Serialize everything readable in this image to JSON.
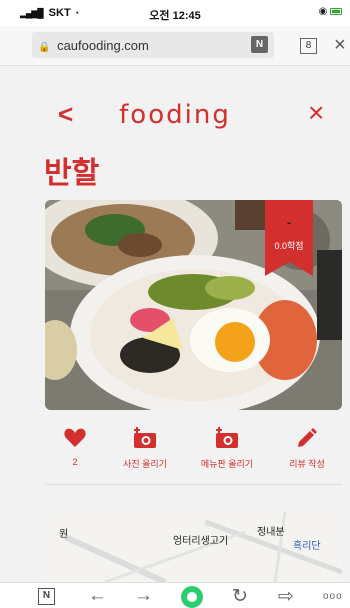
{
  "status_bar": {
    "carrier": "SKT",
    "time": "오전 12:45"
  },
  "browser": {
    "url": "caufooding.com",
    "tab_count": "8"
  },
  "app": {
    "logo": "fooding",
    "back_symbol": "<",
    "close_symbol": "×"
  },
  "restaurant": {
    "name": "반할",
    "rating_dash": "-",
    "rating_text": "0.0학점"
  },
  "actions": [
    {
      "icon": "heart-icon",
      "label": "2"
    },
    {
      "icon": "camera-plus-icon",
      "label": "사진 올리기"
    },
    {
      "icon": "camera-plus-icon",
      "label": "메뉴판 올리기"
    },
    {
      "icon": "pencil-icon",
      "label": "리뷰 작성"
    }
  ],
  "map": {
    "labels": [
      "원",
      "엉터리생고기",
      "정내분",
      "흑리단"
    ]
  },
  "colors": {
    "accent": "#d32f2f",
    "home_green": "#2ecc71"
  }
}
